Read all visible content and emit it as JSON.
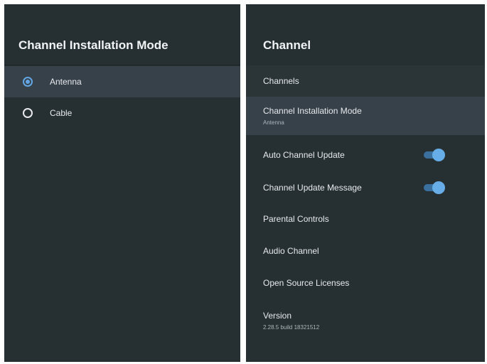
{
  "left_panel": {
    "title": "Channel Installation Mode",
    "options": [
      {
        "label": "Antenna",
        "selected": true
      },
      {
        "label": "Cable",
        "selected": false
      }
    ]
  },
  "right_panel": {
    "title": "Channel",
    "items": [
      {
        "label": "Channels",
        "sublabel": ""
      },
      {
        "label": "Channel Installation Mode",
        "sublabel": "Antenna"
      },
      {
        "label": "Auto Channel Update",
        "toggle": true
      },
      {
        "label": "Channel Update Message",
        "toggle": true
      },
      {
        "label": "Parental Controls"
      },
      {
        "label": "Audio Channel"
      },
      {
        "label": "Open Source Licenses"
      },
      {
        "label": "Version",
        "sublabel": "2.28.5 build 18321512"
      }
    ]
  },
  "colors": {
    "panel_bg": "#263033",
    "highlight_bg": "#37414a",
    "accent": "#63a6e6"
  }
}
